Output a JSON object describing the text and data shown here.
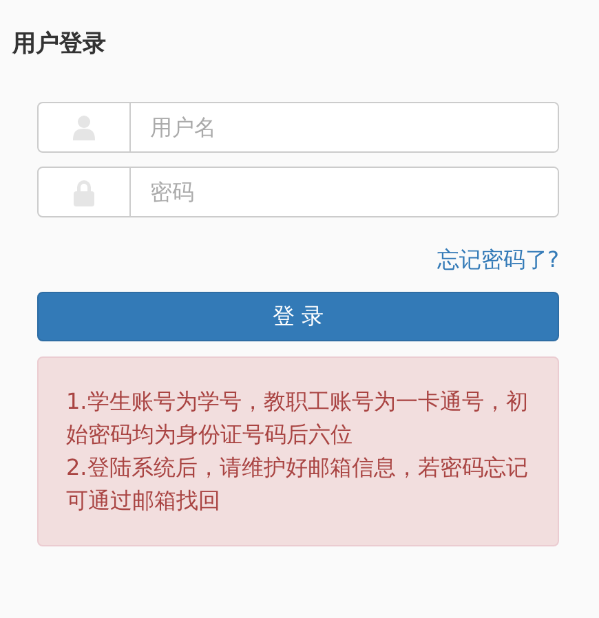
{
  "title": "用户登录",
  "fields": [
    {
      "kind": "user",
      "placeholder": "用户名"
    },
    {
      "kind": "lock",
      "placeholder": "密码"
    }
  ],
  "forgot_link": "忘记密码了?",
  "login_button": "登 录",
  "notice": [
    "1.学生账号为学号，教职工账号为一卡通号，初始密码均为身份证号码后六位",
    "2.登陆系统后，请维护好邮箱信息，若密码忘记可通过邮箱找回"
  ]
}
